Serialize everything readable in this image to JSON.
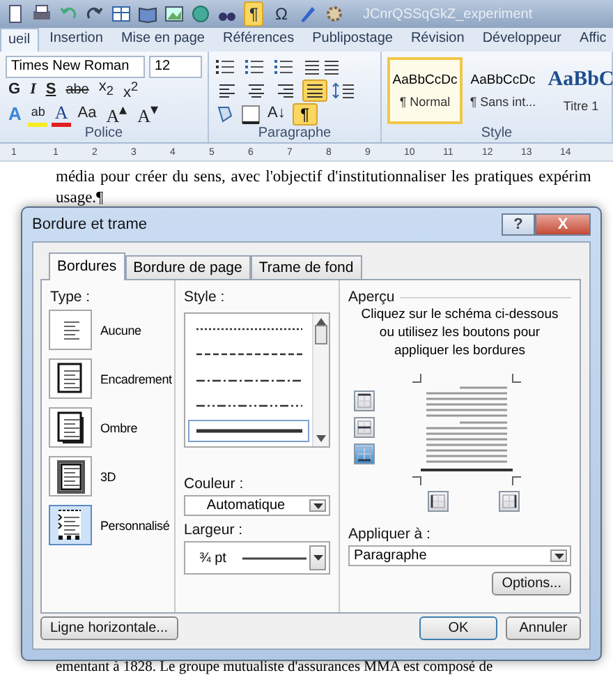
{
  "quick_access": {
    "pilcrow": {
      "glyph": "¶",
      "on": true
    },
    "omega": "Ω",
    "title": "JCnrQSSqGkZ_experiment"
  },
  "ribbon_tabs": [
    {
      "label": "ueil",
      "selected": true
    },
    {
      "label": "Insertion",
      "selected": false
    },
    {
      "label": "Mise en page",
      "selected": false
    },
    {
      "label": "Références",
      "selected": false
    },
    {
      "label": "Publipostage",
      "selected": false
    },
    {
      "label": "Révision",
      "selected": false
    },
    {
      "label": "Développeur",
      "selected": false
    },
    {
      "label": "Affic",
      "selected": false
    }
  ],
  "font_group": {
    "font": "Times New Roman",
    "size": "12",
    "label": "Police",
    "row1": [
      {
        "glyph": "G",
        "kind": "bold"
      },
      {
        "glyph": "I",
        "kind": "italic"
      },
      {
        "glyph": "S",
        "kind": "underline"
      },
      {
        "glyph": "abe",
        "kind": "strike"
      },
      {
        "glyph": "x$_{2}$",
        "kind": "plain"
      },
      {
        "glyph": "x$^{2}$",
        "kind": "plain"
      }
    ],
    "row2": [
      {
        "glyph": "A",
        "kind": "effect"
      },
      {
        "glyph": "ab",
        "kind": "highlight"
      },
      {
        "glyph": "A",
        "kind": "color"
      },
      {
        "glyph": "Aa",
        "kind": "plain"
      },
      {
        "glyph": "A$^{▴}$",
        "kind": "serif"
      },
      {
        "glyph": "A$^{▾}$",
        "kind": "serif"
      }
    ]
  },
  "paragraph_group": {
    "label": "Paragraphe",
    "sort_glyph": "A↓",
    "justify_on": true,
    "show_marks": {
      "glyph": "¶",
      "on": true
    }
  },
  "styles": {
    "label": "Style",
    "items": [
      {
        "sample": "AaBbCcDc",
        "name": "¶ Normal",
        "kind": "body",
        "selected": true
      },
      {
        "sample": "AaBbCcDc",
        "name": "¶ Sans int...",
        "kind": "body",
        "selected": false
      },
      {
        "sample": "AaBbC",
        "name": "Titre 1",
        "kind": "heading",
        "selected": false
      }
    ]
  },
  "ruler": {
    "numbers": [
      "1",
      "1",
      "2",
      "3",
      "4",
      "5",
      "6",
      "7",
      "8",
      "9",
      "10",
      "11",
      "12",
      "13",
      "14"
    ]
  },
  "document": {
    "top_lines": [
      "média pour créer du sens, avec l'objectif d'institutionnaliser les pratiques expérim",
      "usage.¶"
    ],
    "bottom_line": "ementant à 1828. Le groupe mutualiste d'assurances MMA est composé de"
  },
  "dialog": {
    "title": "Bordure et trame",
    "help": "?",
    "close": "X",
    "tabs": [
      {
        "label": "Bordures",
        "selected": true
      },
      {
        "label": "Bordure de page",
        "selected": false
      },
      {
        "label": "Trame de fond",
        "selected": false
      }
    ],
    "type": {
      "label": "Type :",
      "options": [
        {
          "label": "Aucune",
          "kind": "none",
          "selected": false
        },
        {
          "label": "Encadrement",
          "kind": "box",
          "selected": false
        },
        {
          "label": "Ombre",
          "kind": "shadow",
          "selected": false
        },
        {
          "label": "3D",
          "kind": "threed",
          "selected": false
        },
        {
          "label": "Personnalisé",
          "kind": "custom",
          "selected": true
        }
      ]
    },
    "style": {
      "label": "Style :",
      "lines": [
        {
          "kind": "dotted",
          "selected": false
        },
        {
          "kind": "dashed",
          "selected": false
        },
        {
          "kind": "dash-dot",
          "selected": false
        },
        {
          "kind": "dash-dot-dot",
          "selected": false
        },
        {
          "kind": "solid",
          "selected": true
        }
      ]
    },
    "color": {
      "label": "Couleur :",
      "value": "Automatique"
    },
    "width": {
      "label": "Largeur :",
      "value": "¾ pt"
    },
    "preview": {
      "label": "Aperçu",
      "hint": [
        "Cliquez sur le schéma ci-dessous",
        "ou utilisez les boutons pour",
        "appliquer les bordures"
      ],
      "edges": [
        {
          "kind": "top",
          "on": false
        },
        {
          "kind": "middle",
          "on": false
        },
        {
          "kind": "bottom",
          "on": true
        },
        {
          "kind": "left",
          "on": false
        },
        {
          "kind": "right",
          "on": false
        }
      ]
    },
    "apply_to": {
      "label": "Appliquer à :",
      "value": "Paragraphe"
    },
    "options_button": "Options...",
    "horizontal_line_button": "Ligne horizontale...",
    "ok_button": "OK",
    "cancel_button": "Annuler"
  }
}
